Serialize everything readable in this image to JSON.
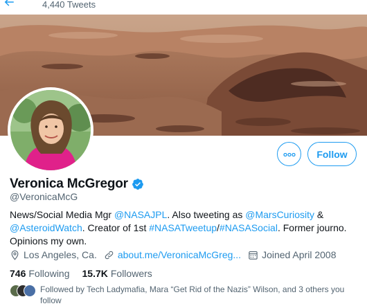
{
  "header": {
    "tweet_count": "4,440 Tweets"
  },
  "profile": {
    "display_name": "Veronica McGregor",
    "handle": "@VeronicaMcG",
    "follow_label": "Follow",
    "bio": {
      "part1": "News/Social Media Mgr ",
      "link1": "@NASAJPL",
      "part2": ". Also tweeting as ",
      "link2": "@MarsCuriosity",
      "part3": " & ",
      "link3": "@AsteroidWatch",
      "part4": ". Creator of 1st ",
      "link4": "#NASATweetup",
      "part5": "/",
      "link5": "#NASASocial",
      "part6": ". Former journo. Opinions my own."
    },
    "location": "Los Angeles, Ca.",
    "website": "about.me/VeronicaMcGreg...",
    "joined": "Joined April 2008",
    "following_count": "746",
    "following_label": "Following",
    "followers_count": "15.7K",
    "followers_label": "Followers",
    "followed_by_text": "Followed by Tech Ladymafia, Mara “Get Rid of the Nazis” Wilson, and 3 others you follow"
  },
  "colors": {
    "accent": "#1d9bf0",
    "secondary_text": "#536471",
    "primary_text": "#0f1419",
    "avatar_background": "#e0218a"
  },
  "icons": {
    "back": "arrow-left-icon",
    "more": "more-dots-icon",
    "verified": "verified-badge-icon",
    "location": "location-pin-icon",
    "link": "link-icon",
    "calendar": "calendar-icon"
  }
}
